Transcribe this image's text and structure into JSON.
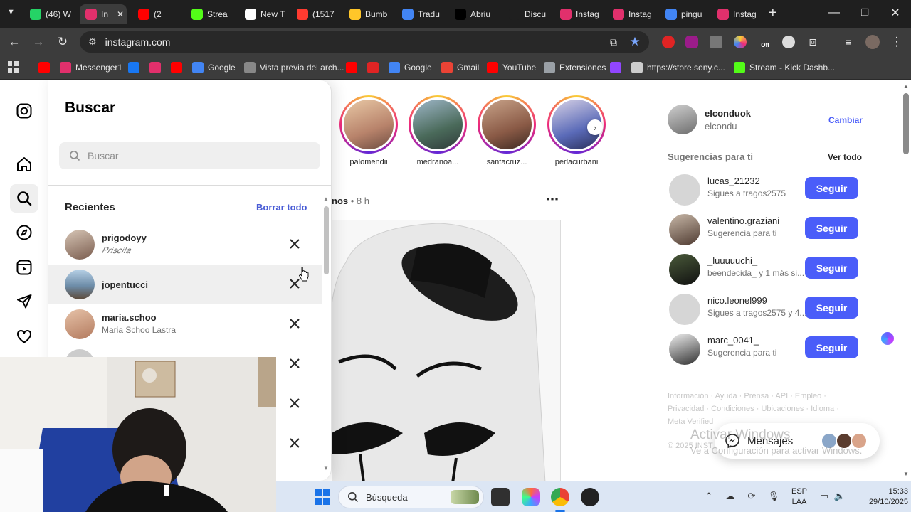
{
  "browser": {
    "tabs": [
      {
        "label": "(46) W",
        "color": "#25d366",
        "icon": "whatsapp-icon"
      },
      {
        "label": "In",
        "color": "#e1306c",
        "icon": "instagram-icon",
        "active": true
      },
      {
        "label": "(2",
        "color": "#ff0000",
        "icon": "youtube-icon"
      },
      {
        "label": "Strea",
        "color": "#53fc18",
        "icon": "kick-icon"
      },
      {
        "label": "New T",
        "color": "#ffffff",
        "icon": "chrome-icon"
      },
      {
        "label": "(1517",
        "color": "#ff3b30",
        "icon": "notification-icon"
      },
      {
        "label": "Bumb",
        "color": "#ffc629",
        "icon": "bumble-icon"
      },
      {
        "label": "Tradu",
        "color": "#4285f4",
        "icon": "translate-icon"
      },
      {
        "label": "Abriu",
        "color": "#000000",
        "icon": "tiktok-icon"
      },
      {
        "label": "Discu",
        "color": "#1f1f1f",
        "icon": "discussion-icon"
      },
      {
        "label": "Instag",
        "color": "#e1306c",
        "icon": "instagram-icon"
      },
      {
        "label": "Instag",
        "color": "#e1306c",
        "icon": "instagram-icon"
      },
      {
        "label": "pingu",
        "color": "#4285f4",
        "icon": "google-icon"
      },
      {
        "label": "Instag",
        "color": "#e1306c",
        "icon": "instagram-icon"
      }
    ],
    "url": "instagram.com",
    "bookmarks": [
      {
        "label": "",
        "color": "#ff0000"
      },
      {
        "label": "Messenger1",
        "color": "#e1306c"
      },
      {
        "label": "",
        "color": "#1877f2"
      },
      {
        "label": "",
        "color": "#e1306c"
      },
      {
        "label": "",
        "color": "#ff0000"
      },
      {
        "label": "Google",
        "color": "#4285f4"
      },
      {
        "label": "Vista previa del arch...",
        "color": "#888888"
      },
      {
        "label": "",
        "color": "#ff0000"
      },
      {
        "label": "",
        "color": "#e02424"
      },
      {
        "label": "Google",
        "color": "#4285f4"
      },
      {
        "label": "Gmail",
        "color": "#ea4335"
      },
      {
        "label": "YouTube",
        "color": "#ff0000"
      },
      {
        "label": "Extensiones",
        "color": "#9aa0a6"
      },
      {
        "label": "",
        "color": "#9146ff"
      },
      {
        "label": "https://store.sony.c...",
        "color": "#cccccc"
      },
      {
        "label": "Stream - Kick Dashb...",
        "color": "#53fc18"
      }
    ]
  },
  "search_panel": {
    "title": "Buscar",
    "placeholder": "Buscar",
    "recents_label": "Recientes",
    "clear_all": "Borrar todo",
    "recents": [
      {
        "username": "prigodoyy_",
        "subtitle": "𝑃𝑟𝑖𝑠𝑐𝑖𝑙𝑎"
      },
      {
        "username": "jopentucci",
        "subtitle": ""
      },
      {
        "username": "maria.schoo",
        "subtitle": "Maria Schoo Lastra"
      }
    ]
  },
  "feed": {
    "stories": [
      {
        "name": "palomendii"
      },
      {
        "name": "medranoa..."
      },
      {
        "name": "santacruz..."
      },
      {
        "name": "perlacurbani"
      }
    ],
    "post_header": "nos",
    "post_time": "8 h"
  },
  "sidebar_right": {
    "account_username": "elconduok",
    "account_name": "elcondu",
    "switch_label": "Cambiar",
    "suggestions_label": "Sugerencias para ti",
    "see_all": "Ver todo",
    "suggestions": [
      {
        "username": "lucas_21232",
        "subtitle": "Sigues a tragos2575",
        "button": "Seguir"
      },
      {
        "username": "valentino.graziani",
        "subtitle": "Sugerencia para ti",
        "button": "Seguir"
      },
      {
        "username": "_luuuuuchi_",
        "subtitle": "beendecida_ y 1 más si...",
        "button": "Seguir"
      },
      {
        "username": "nico.leonel999",
        "subtitle": "Sigues a tragos2575 y 4...",
        "button": "Seguir"
      },
      {
        "username": "marc_0041_",
        "subtitle": "Sugerencia para ti",
        "button": "Seguir"
      }
    ],
    "footer_line1": "Información · Ayuda · Prensa · API · Empleo ·",
    "footer_line2": "Privacidad · Condiciones · Ubicaciones · Idioma ·",
    "footer_line3": "Meta Verified",
    "copyright": "© 2025 INST",
    "messages_label": "Mensajes"
  },
  "watermark": {
    "line1": "Activar Windows",
    "line2": "Ve a Configuración para activar Windows."
  },
  "taskbar": {
    "search_placeholder": "Búsqueda",
    "lang_top": "ESP",
    "lang_bottom": "LAA",
    "time": "15:33",
    "date": "29/10/2025"
  }
}
